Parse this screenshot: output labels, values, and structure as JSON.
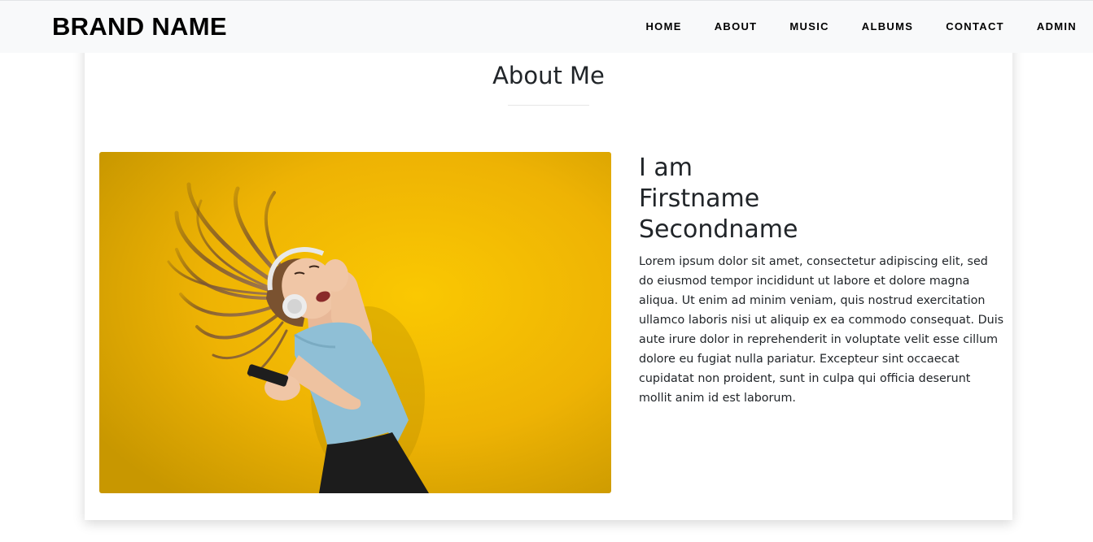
{
  "navbar": {
    "brand": "BRAND NAME",
    "links": [
      "HOME",
      "ABOUT",
      "MUSIC",
      "ALBUMS",
      "CONTACT",
      "ADMIN"
    ]
  },
  "about": {
    "title": "About Me",
    "heading_lines": [
      "I am",
      "Firstname",
      "Secondname"
    ],
    "bio": "Lorem ipsum dolor sit amet, consectetur adipiscing elit, sed do eiusmod tempor incididunt ut labore et dolore magna aliqua. Ut enim ad minim veniam, quis nostrud exercitation ullamco laboris nisi ut aliquip ex ea commodo consequat. Duis aute irure dolor in reprehenderit in voluptate velit esse cillum dolore eu fugiat nulla pariatur. Excepteur sint occaecat cupidatat non proident, sunt in culpa qui officia deserunt mollit anim id est laborum."
  },
  "colors": {
    "navbar_bg": "#f8f9fa",
    "photo_bg": "#f2b705",
    "text": "#212529"
  }
}
